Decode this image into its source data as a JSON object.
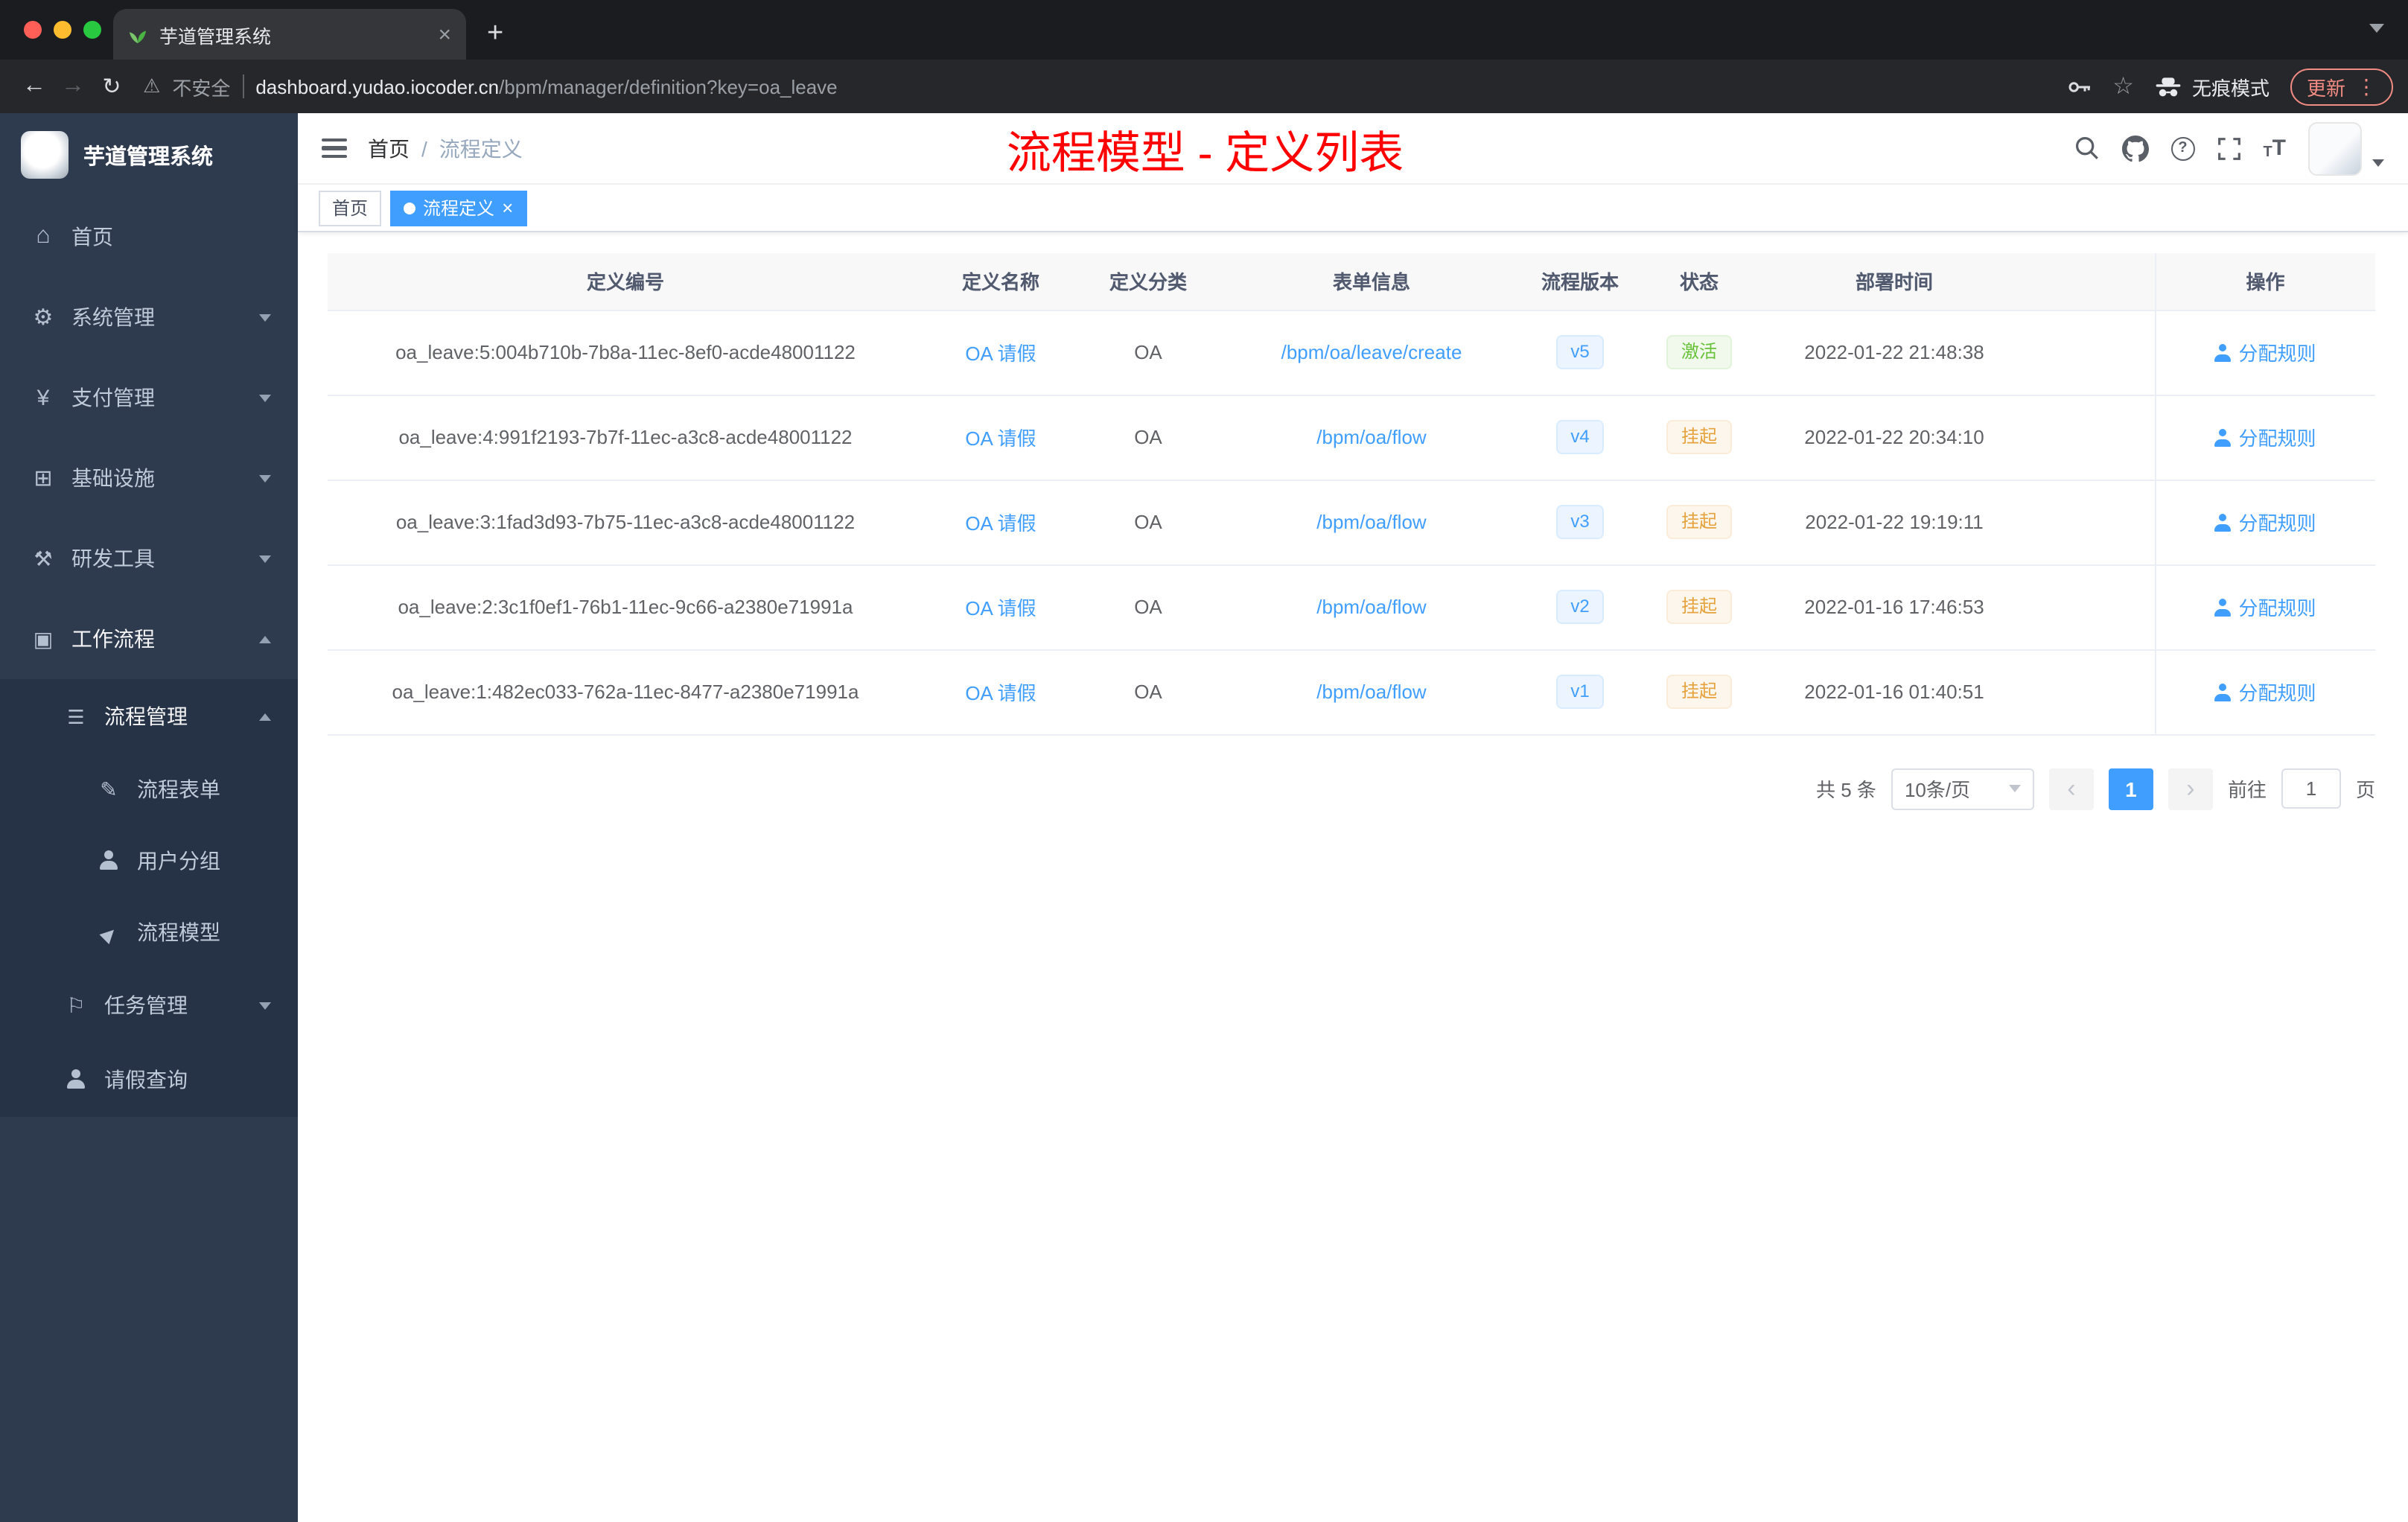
{
  "browser": {
    "tab_title": "芋道管理系统",
    "security_label": "不安全",
    "url_host": "dashboard.yudao.iocoder.cn",
    "url_path": "/bpm/manager/definition?key=oa_leave",
    "incognito_label": "无痕模式",
    "update_label": "更新"
  },
  "sidebar": {
    "logo_title": "芋道管理系统",
    "items": [
      {
        "label": "首页",
        "icon": "home-icon"
      },
      {
        "label": "系统管理",
        "icon": "gear-icon"
      },
      {
        "label": "支付管理",
        "icon": "payment-icon"
      },
      {
        "label": "基础设施",
        "icon": "infrastructure-icon"
      },
      {
        "label": "研发工具",
        "icon": "dev-tools-icon"
      },
      {
        "label": "工作流程",
        "icon": "workflow-icon"
      },
      {
        "label": "流程管理",
        "icon": "process-list-icon"
      },
      {
        "label": "流程表单",
        "icon": "form-icon"
      },
      {
        "label": "用户分组",
        "icon": "user-group-icon"
      },
      {
        "label": "流程模型",
        "icon": "send-icon"
      },
      {
        "label": "任务管理",
        "icon": "task-flag-icon"
      },
      {
        "label": "请假查询",
        "icon": "person-icon"
      }
    ]
  },
  "navbar": {
    "breadcrumb_home": "首页",
    "breadcrumb_sep": "/",
    "breadcrumb_current": "流程定义",
    "annotation": "流程模型 - 定义列表",
    "icons": [
      "search-icon",
      "github-icon",
      "help-icon",
      "fullscreen-icon",
      "font-size-icon",
      "avatar"
    ]
  },
  "tags": {
    "home": "首页",
    "current": "流程定义"
  },
  "table": {
    "columns": [
      "定义编号",
      "定义名称",
      "定义分类",
      "表单信息",
      "流程版本",
      "状态",
      "部署时间",
      "操作"
    ],
    "rows": [
      {
        "id": "oa_leave:5:004b710b-7b8a-11ec-8ef0-acde48001122",
        "name": "OA 请假",
        "category": "OA",
        "form": "/bpm/oa/leave/create",
        "version": "v5",
        "status": "激活",
        "status_type": "success",
        "time": "2022-01-22 21:48:38",
        "action": "分配规则"
      },
      {
        "id": "oa_leave:4:991f2193-7b7f-11ec-a3c8-acde48001122",
        "name": "OA 请假",
        "category": "OA",
        "form": "/bpm/oa/flow",
        "version": "v4",
        "status": "挂起",
        "status_type": "warning",
        "time": "2022-01-22 20:34:10",
        "action": "分配规则"
      },
      {
        "id": "oa_leave:3:1fad3d93-7b75-11ec-a3c8-acde48001122",
        "name": "OA 请假",
        "category": "OA",
        "form": "/bpm/oa/flow",
        "version": "v3",
        "status": "挂起",
        "status_type": "warning",
        "time": "2022-01-22 19:19:11",
        "action": "分配规则"
      },
      {
        "id": "oa_leave:2:3c1f0ef1-76b1-11ec-9c66-a2380e71991a",
        "name": "OA 请假",
        "category": "OA",
        "form": "/bpm/oa/flow",
        "version": "v2",
        "status": "挂起",
        "status_type": "warning",
        "time": "2022-01-16 17:46:53",
        "action": "分配规则"
      },
      {
        "id": "oa_leave:1:482ec033-762a-11ec-8477-a2380e71991a",
        "name": "OA 请假",
        "category": "OA",
        "form": "/bpm/oa/flow",
        "version": "v1",
        "status": "挂起",
        "status_type": "warning",
        "time": "2022-01-16 01:40:51",
        "action": "分配规则"
      }
    ]
  },
  "pagination": {
    "total": "共 5 条",
    "page_size": "10条/页",
    "current_page": "1",
    "goto_label": "前往",
    "goto_value": "1",
    "page_unit": "页"
  },
  "colors": {
    "primary": "#409eff",
    "success": "#67c23a",
    "warning": "#e6a23c",
    "annotation_red": "#ff0000",
    "sidebar_bg": "#2e3a4e"
  }
}
